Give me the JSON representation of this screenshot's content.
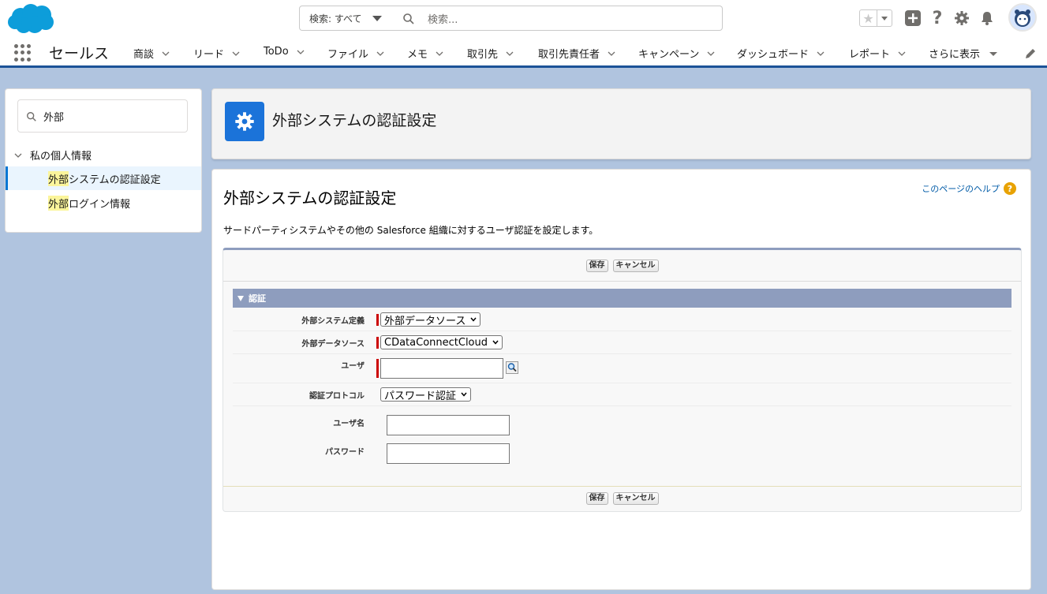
{
  "header": {
    "search_scope": "検索: すべて",
    "search_placeholder": "検索..."
  },
  "nav": {
    "app_name": "セールス",
    "items": [
      "商談",
      "リード",
      "ToDo",
      "ファイル",
      "メモ",
      "取引先",
      "取引先責任者",
      "キャンペーン",
      "ダッシュボード",
      "レポート"
    ],
    "more": "さらに表示"
  },
  "sidebar": {
    "quickfind_value": "外部",
    "parent": "私の個人情報",
    "items": [
      {
        "highlight": "外部",
        "rest": "システムの認証設定",
        "selected": true
      },
      {
        "highlight": "外部",
        "rest": "ログイン情報",
        "selected": false
      }
    ]
  },
  "page": {
    "header_title": "外部システムの認証設定",
    "title": "外部システムの認証設定",
    "help_label": "このページのヘルプ",
    "description": "サードパーティシステムやその他の Salesforce 組織に対するユーザ認証を設定します。",
    "save_label": "保存",
    "cancel_label": "キャンセル",
    "section_title": "認証"
  },
  "form": {
    "system_definition": {
      "label": "外部システム定義",
      "value": "外部データソース"
    },
    "data_source": {
      "label": "外部データソース",
      "value": "CDataConnectCloud"
    },
    "user": {
      "label": "ユーザ",
      "value": ""
    },
    "auth_protocol": {
      "label": "認証プロトコル",
      "value": "パスワード認証"
    },
    "username": {
      "label": "ユーザ名",
      "value": ""
    },
    "password": {
      "label": "パスワード",
      "value": ""
    }
  },
  "colors": {
    "brand": "#0176d3",
    "section_header": "#8e9dbe",
    "required": "#cc0000"
  }
}
